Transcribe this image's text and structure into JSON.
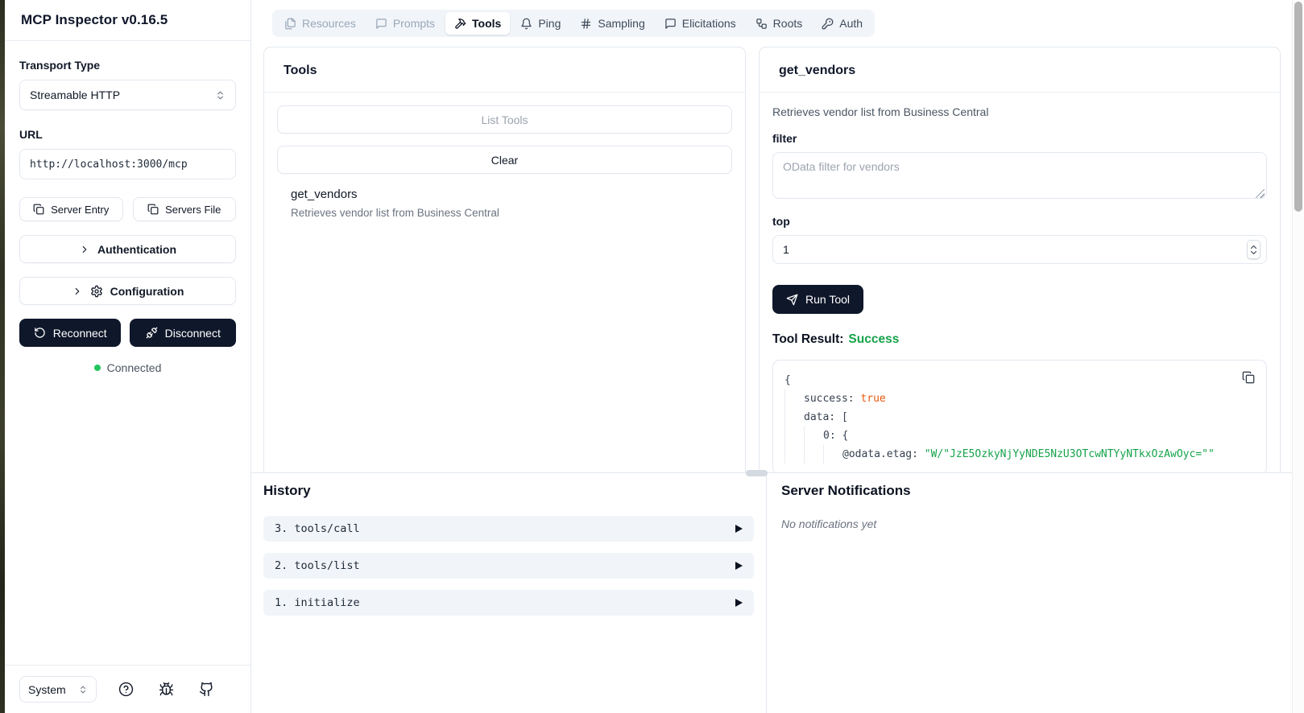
{
  "app": {
    "title": "MCP Inspector v0.16.5"
  },
  "sidebar": {
    "transport": {
      "label": "Transport Type",
      "value": "Streamable HTTP"
    },
    "url": {
      "label": "URL",
      "value": "http://localhost:3000/mcp"
    },
    "buttons": {
      "server_entry": "Server Entry",
      "servers_file": "Servers File",
      "authentication": "Authentication",
      "configuration": "Configuration",
      "reconnect": "Reconnect",
      "disconnect": "Disconnect"
    },
    "status": {
      "connected": "Connected"
    },
    "footer": {
      "theme": "System"
    }
  },
  "tabs": [
    {
      "label": "Resources",
      "state": "disabled"
    },
    {
      "label": "Prompts",
      "state": "disabled"
    },
    {
      "label": "Tools",
      "state": "active"
    },
    {
      "label": "Ping",
      "state": "normal"
    },
    {
      "label": "Sampling",
      "state": "normal"
    },
    {
      "label": "Elicitations",
      "state": "normal"
    },
    {
      "label": "Roots",
      "state": "normal"
    },
    {
      "label": "Auth",
      "state": "normal"
    }
  ],
  "tools_panel": {
    "title": "Tools",
    "list_tools": "List Tools",
    "clear": "Clear",
    "items": [
      {
        "name": "get_vendors",
        "description": "Retrieves vendor list from Business Central"
      }
    ]
  },
  "tool_form": {
    "title": "get_vendors",
    "description": "Retrieves vendor list from Business Central",
    "filter_label": "filter",
    "filter_placeholder": "OData filter for vendors",
    "top_label": "top",
    "top_value": "1",
    "run_button": "Run Tool",
    "result_label": "Tool Result:",
    "result_status": "Success"
  },
  "result_json": {
    "lines": [
      {
        "segments": [
          {
            "text": "{"
          }
        ]
      },
      {
        "segments": [
          {
            "text": "success: "
          },
          {
            "text": "true"
          }
        ]
      },
      {
        "segments": [
          {
            "text": "data: ["
          }
        ]
      },
      {
        "segments": [
          {
            "text": "0: {"
          }
        ]
      },
      {
        "segments": [
          {
            "text": "@odata.etag: "
          },
          {
            "text": "\"W/\"JzE5OzkyNjYyNDE5NzU3OTcwNTYyNTkxOzAwOyc=\"\""
          }
        ]
      }
    ]
  },
  "history": {
    "title": "History",
    "items": [
      {
        "label": "3. tools/call"
      },
      {
        "label": "2. tools/list"
      },
      {
        "label": "1. initialize"
      }
    ]
  },
  "notifications": {
    "title": "Server Notifications",
    "empty": "No notifications yet"
  },
  "colors": {
    "accent_dark": "#0f172a",
    "success_green": "#16a34a",
    "boolean_orange": "#ea580c",
    "string_green": "#16a34a",
    "connected_dot": "#22c55e",
    "tabbar_bg": "#f1f5f9",
    "border": "#e2e8f0"
  }
}
